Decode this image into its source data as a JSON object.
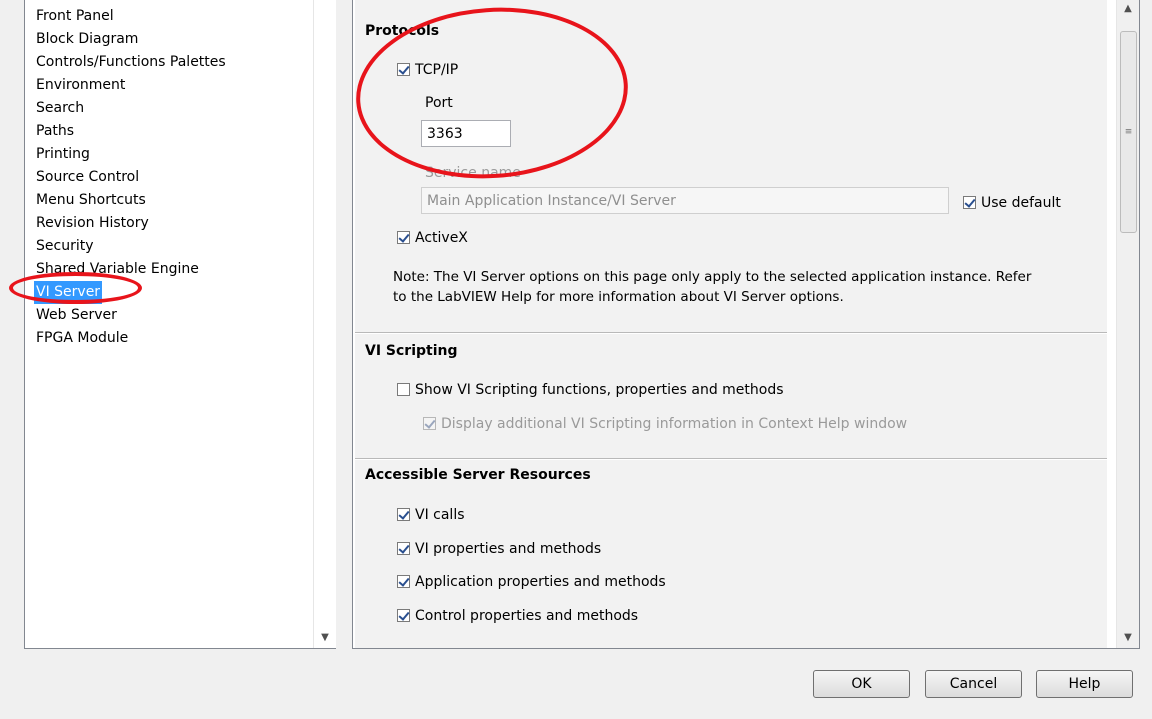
{
  "categories": {
    "items": [
      "Front Panel",
      "Block Diagram",
      "Controls/Functions Palettes",
      "Environment",
      "Search",
      "Paths",
      "Printing",
      "Source Control",
      "Menu Shortcuts",
      "Revision History",
      "Security",
      "Shared Variable Engine",
      "VI Server",
      "Web Server",
      "FPGA Module"
    ],
    "selected": "VI Server"
  },
  "protocols": {
    "heading": "Protocols",
    "tcpip_label": "TCP/IP",
    "tcpip_checked": true,
    "port_label": "Port",
    "port_value": "3363",
    "service_name_label": "Service name",
    "service_name_value": "Main Application Instance/VI Server",
    "use_default_label": "Use default",
    "use_default_checked": true,
    "activex_label": "ActiveX",
    "activex_checked": true,
    "note": "Note: The VI Server options on this page only apply to the selected application instance. Refer to the LabVIEW Help for more information about VI Server options.",
    "note_line1": "Note: The VI Server options on this page only apply to the selected application instance. Refer",
    "note_line2": "to the LabVIEW Help for more information about VI Server options."
  },
  "vi_scripting": {
    "heading": "VI Scripting",
    "show_label": "Show VI Scripting functions, properties and methods",
    "show_checked": false,
    "display_label": "Display additional VI Scripting information in Context Help window",
    "display_checked": true
  },
  "resources": {
    "heading": "Accessible Server Resources",
    "vi_calls_label": "VI calls",
    "vi_props_label": "VI properties and methods",
    "app_props_label": "Application properties and methods",
    "control_props_label": "Control properties and methods"
  },
  "buttons": {
    "ok": "OK",
    "cancel": "Cancel",
    "help": "Help"
  },
  "colors": {
    "selection": "#3399ff",
    "annotation": "#e8141b"
  },
  "icons": {
    "checkbox_checked": "checkbox-checked-icon",
    "scroll_up": "scroll-up-arrow-icon",
    "scroll_down": "scroll-down-arrow-icon",
    "scroll_grip": "scroll-grip-icon"
  }
}
